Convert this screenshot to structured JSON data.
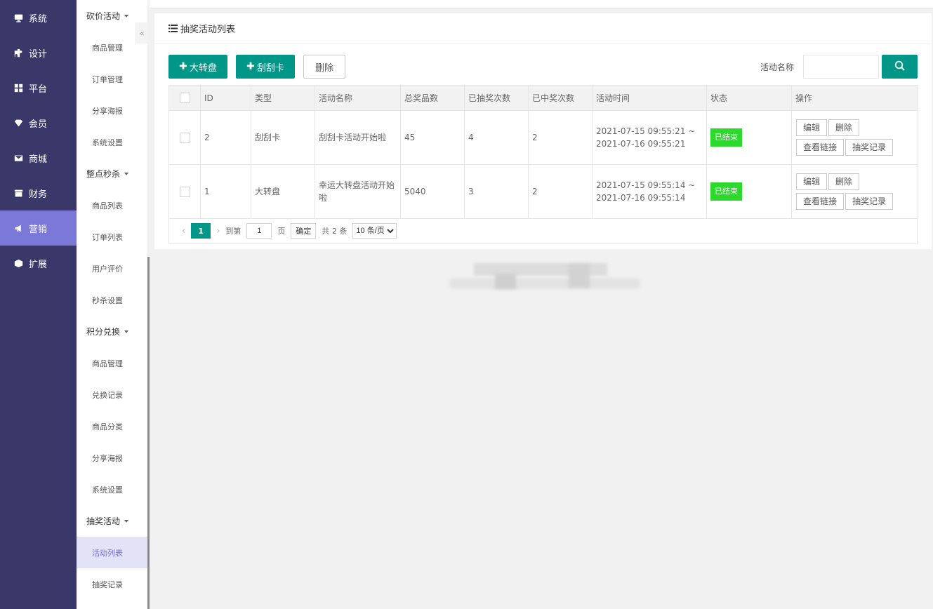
{
  "main_nav": [
    {
      "label": "系统",
      "icon": "monitor-icon"
    },
    {
      "label": "设计",
      "icon": "puzzle-icon"
    },
    {
      "label": "平台",
      "icon": "grid-icon"
    },
    {
      "label": "会员",
      "icon": "diamond-icon"
    },
    {
      "label": "商城",
      "icon": "mail-icon"
    },
    {
      "label": "财务",
      "icon": "inbox-icon"
    },
    {
      "label": "营销",
      "icon": "megaphone-icon",
      "active": true
    },
    {
      "label": "扩展",
      "icon": "cube-icon"
    }
  ],
  "sub_nav": {
    "groups": [
      {
        "label": "砍价活动",
        "items": [
          "商品管理",
          "订单管理",
          "分享海报",
          "系统设置"
        ]
      },
      {
        "label": "整点秒杀",
        "items": [
          "商品列表",
          "订单列表",
          "用户评价",
          "秒杀设置"
        ]
      },
      {
        "label": "积分兑换",
        "items": [
          "商品管理",
          "兑换记录",
          "商品分类",
          "分享海报",
          "系统设置"
        ]
      },
      {
        "label": "抽奖活动",
        "items": [
          "活动列表",
          "抽奖记录"
        ]
      }
    ],
    "active_item": "活动列表",
    "collapse_glyph": "«"
  },
  "card": {
    "title": "抽奖活动列表",
    "buttons": {
      "add_wheel": "大转盘",
      "add_scratch": "刮刮卡",
      "delete": "删除"
    },
    "search": {
      "label": "活动名称",
      "value": ""
    }
  },
  "table": {
    "headers": [
      "",
      "ID",
      "类型",
      "活动名称",
      "总奖品数",
      "已抽奖次数",
      "已中奖次数",
      "活动时间",
      "状态",
      "操作"
    ],
    "rows": [
      {
        "id": "2",
        "type": "刮刮卡",
        "name": "刮刮卡活动开始啦",
        "total": "45",
        "draws": "4",
        "wins": "2",
        "time_start": "2021-07-15 09:55:21 ~",
        "time_end": "2021-07-16 09:55:21",
        "status": "已结束"
      },
      {
        "id": "1",
        "type": "大转盘",
        "name": "幸运大转盘活动开始啦",
        "total": "5040",
        "draws": "3",
        "wins": "2",
        "time_start": "2021-07-15 09:55:14 ~",
        "time_end": "2021-07-16 09:55:14",
        "status": "已结束"
      }
    ],
    "ops": {
      "edit": "编辑",
      "delete": "删除",
      "view_link": "查看链接",
      "records": "抽奖记录"
    }
  },
  "pager": {
    "current": "1",
    "goto_label": "到第",
    "goto_value": "1",
    "page_unit": "页",
    "confirm": "确定",
    "total": "共 2 条",
    "page_size": "10 条/页",
    "prev": "‹",
    "next": "›"
  },
  "colors": {
    "sidebar": "#3a3868",
    "sidebar_active": "#7b78d8",
    "primary": "#009688",
    "status_green": "#2ed92e"
  }
}
